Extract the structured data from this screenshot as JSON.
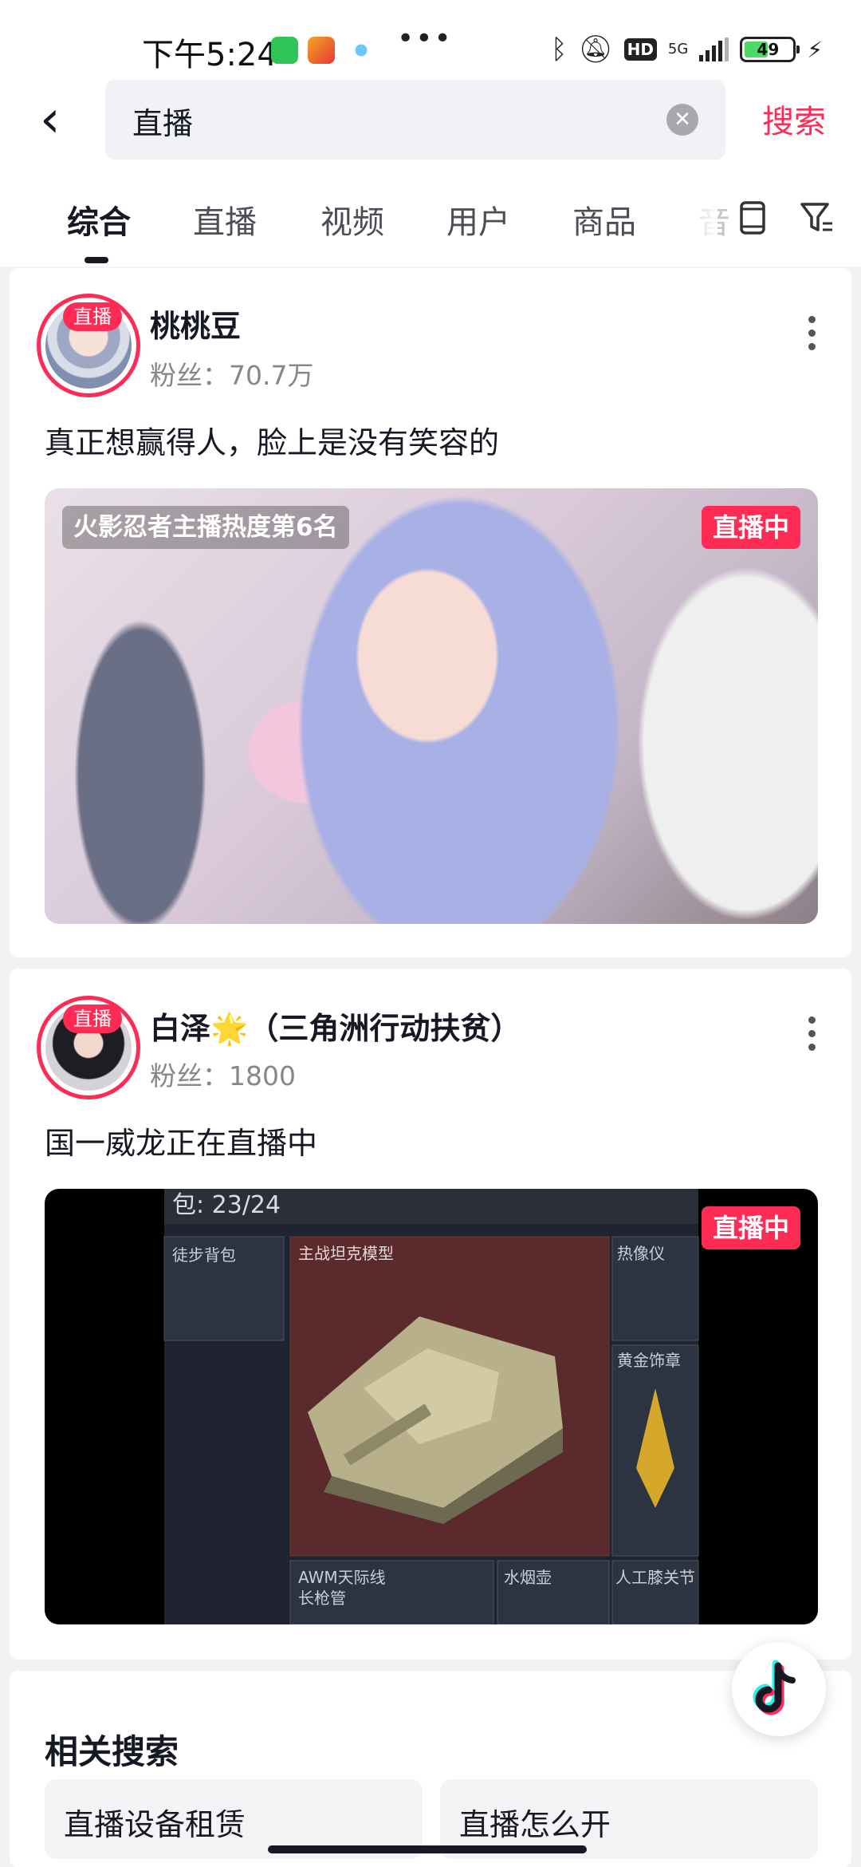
{
  "status_bar": {
    "time": "下午5:24",
    "net_badge": "5G",
    "hd_badge": "HD",
    "battery_percent": "49",
    "signal_bars": 4
  },
  "search": {
    "query": "直播",
    "submit_label": "搜索"
  },
  "tabs": [
    {
      "label": "综合",
      "active": true
    },
    {
      "label": "直播",
      "active": false
    },
    {
      "label": "视频",
      "active": false
    },
    {
      "label": "用户",
      "active": false
    },
    {
      "label": "商品",
      "active": false
    },
    {
      "label": "音",
      "active": false
    }
  ],
  "results": [
    {
      "avatar_badge": "直播",
      "name": "桃桃豆",
      "fans": "粉丝：70.7万",
      "desc": "真正想赢得人，脸上是没有笑容的",
      "rank_tag": "火影忍者主播热度第6名",
      "live_tag": "直播中"
    },
    {
      "avatar_badge": "直播",
      "name": "白泽🌟（三角洲行动扶贫）",
      "fans": "粉丝：1800",
      "desc": "国一威龙正在直播中",
      "live_tag": "直播中",
      "game_overlay": {
        "counter": "包: 23/24",
        "label_backpack": "徒步背包",
        "label_tank": "主战坦克模型",
        "label_thermal": "热像仪",
        "label_gold": "黄金饰章",
        "label_awm": "AWM天际线",
        "label_awm_sub": "长枪管",
        "label_pipe": "水烟壶",
        "label_knee": "人工膝关节"
      }
    }
  ],
  "related": {
    "title": "相关搜索",
    "items": [
      "直播设备租赁",
      "直播怎么开"
    ]
  },
  "colors": {
    "accent": "#fe2c55",
    "text_primary": "#161823",
    "text_secondary": "#86878b",
    "background": "#f2f2f4"
  }
}
